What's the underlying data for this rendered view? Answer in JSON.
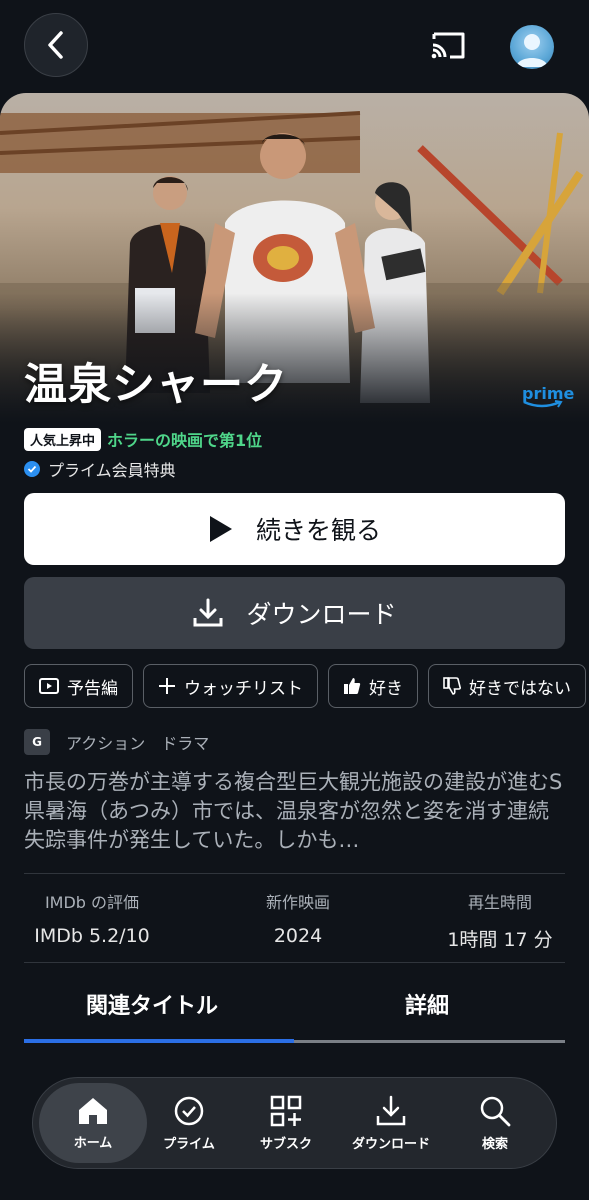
{
  "title": "温泉シャーク",
  "prime_logo": "prime",
  "rank": {
    "badge": "人気上昇中",
    "text": "ホラーの映画で第1位"
  },
  "membership": "プライム会員特典",
  "actions": {
    "play": "続きを観る",
    "download": "ダウンロード"
  },
  "chips": {
    "trailer": "予告編",
    "watchlist": "ウォッチリスト",
    "like": "好き",
    "dislike": "好きではない"
  },
  "rating": "G",
  "genres": [
    "アクション",
    "ドラマ"
  ],
  "synopsis": "市長の万巻が主導する複合型巨大観光施設の建設が進むS県暑海（あつみ）市では、温泉客が忽然と姿を消す連続失踪事件が発生していた。しかも…",
  "meta": {
    "imdb_label": "IMDb の評価",
    "imdb_value": "IMDb 5.2/10",
    "release_label": "新作映画",
    "release_value": "2024",
    "runtime_label": "再生時間",
    "runtime_value": "1時間 17 分"
  },
  "tabs": {
    "related": "関連タイトル",
    "details": "詳細"
  },
  "nav": {
    "home": "ホーム",
    "prime": "プライム",
    "subscriptions": "サブスク",
    "downloads": "ダウンロード",
    "search": "検索"
  },
  "colors": {
    "accent": "#2b6fe6",
    "rank_green": "#4fd68a",
    "background": "#0f1319"
  }
}
